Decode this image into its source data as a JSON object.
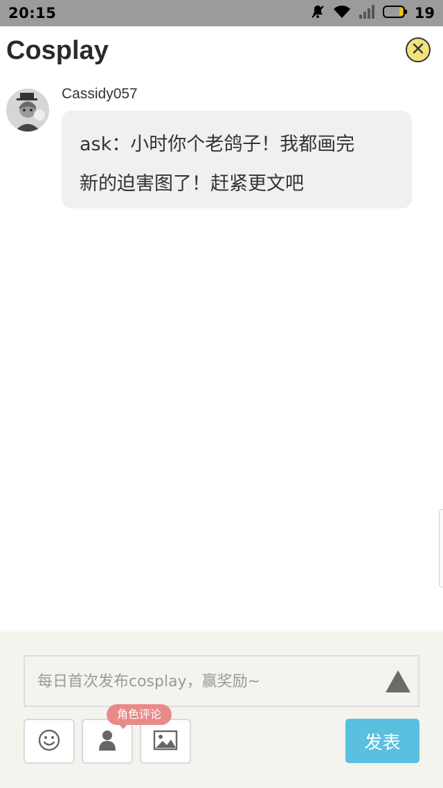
{
  "status_bar": {
    "time": "20:15",
    "battery": "19",
    "icons": [
      "muted-bell-icon",
      "wifi-icon",
      "signal-icon",
      "battery-icon"
    ]
  },
  "header": {
    "title": "Cosplay",
    "close_icon": "close-circle-icon"
  },
  "post": {
    "username": "Cassidy057",
    "message_line1": "ask：小时你个老鸽子！我都画完",
    "message_line2": "新的迫害图了！赶紧更文吧"
  },
  "composer": {
    "placeholder": "每日首次发布cosplay，赢奖励~",
    "tooltip": "角色评论",
    "send_label": "发表",
    "tools": [
      "emoji-icon",
      "character-icon",
      "image-icon"
    ]
  },
  "colors": {
    "status_bar": "#9b9b9b",
    "close_button": "#f2e27c",
    "bubble": "#f0f0f0",
    "composer_bg": "#f4f3ee",
    "tooltip": "#e98a8a",
    "send_button": "#5bc0e0"
  }
}
